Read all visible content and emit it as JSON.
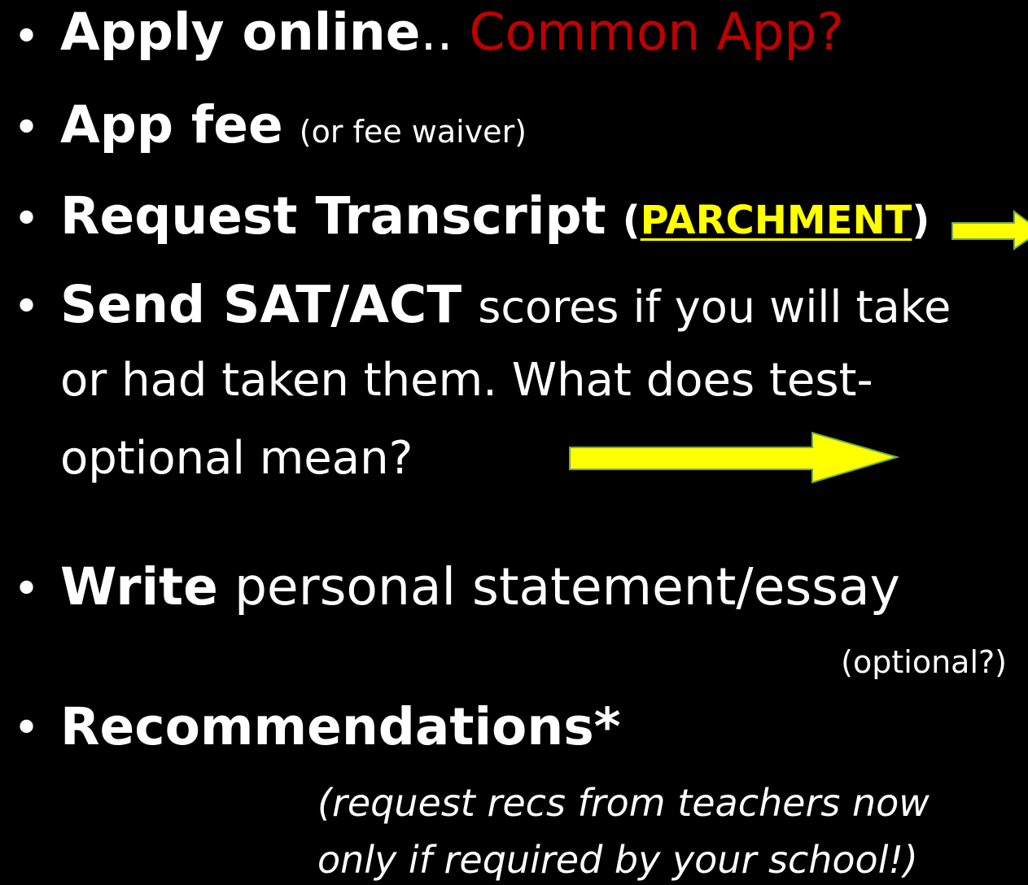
{
  "bullets": {
    "apply": {
      "bold": "Apply online",
      "punct": "..",
      "highlight": "Common App?"
    },
    "fee": {
      "bold": "App fee",
      "note": "(or fee waiver)"
    },
    "transcript": {
      "bold": "Request Transcript",
      "open_paren": "(",
      "link": "PARCHMENT",
      "close_paren": ")"
    },
    "scores": {
      "bold": "Send SAT/ACT",
      "line1_rest": "scores if you will take",
      "line2": "or had taken them. What does test-",
      "line3": "optional mean?"
    },
    "write": {
      "bold": "Write",
      "rest": "personal statement/essay",
      "note": "(optional?)"
    },
    "recs": {
      "bold": "Recommendations*",
      "note_line1": "(request recs from teachers now",
      "note_line2": "only if required by your school!)"
    }
  },
  "bullet_glyph": "•",
  "colors": {
    "background": "#000000",
    "text": "#ffffff",
    "accent_red": "#c00000",
    "link_yellow": "#ffff00",
    "arrow_fill": "#ffff00",
    "arrow_outline": "#70ad47"
  }
}
